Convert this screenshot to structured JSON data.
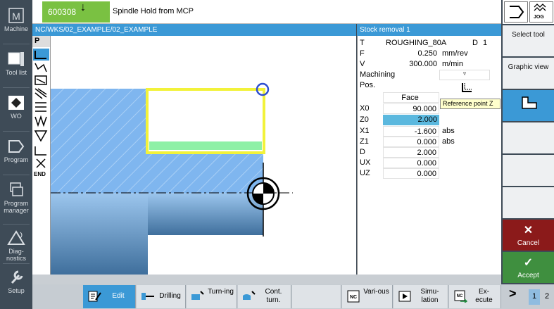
{
  "sidebar": {
    "items": [
      {
        "label": "Machine",
        "icon": "machine-icon"
      },
      {
        "label": "Tool list",
        "icon": "tool-list-icon"
      },
      {
        "label": "WO",
        "icon": "work-offset-icon"
      },
      {
        "label": "Program",
        "icon": "program-icon"
      },
      {
        "label": "Program manager",
        "icon": "program-manager-icon"
      },
      {
        "label": "Diag-nostics",
        "icon": "diagnostics-icon"
      },
      {
        "label": "Setup",
        "icon": "setup-icon"
      }
    ]
  },
  "header": {
    "alarm_number": "600308",
    "alarm_text": "Spindle Hold from MCP",
    "jog_label": "JOG"
  },
  "path": "NC/WKS/02_EXAMPLE/02_EXAMPLE",
  "cycle_title": "Stock removal 1",
  "strategy": {
    "p_label": "P",
    "end_label": "END"
  },
  "params": {
    "t_label": "T",
    "t_value": "ROUGHING_80A",
    "d_label": "D",
    "d_value": "1",
    "f_label": "F",
    "f_value": "0.250",
    "f_unit": "mm/rev",
    "v_label": "V",
    "v_value": "300.000",
    "v_unit": "m/min",
    "machining_label": "Machining",
    "machining_value": "▿",
    "pos_label": "Pos.",
    "face_value": "Face",
    "x0_label": "X0",
    "x0_value": "90.000",
    "z0_label": "Z0",
    "z0_value": "2.000",
    "x1_label": "X1",
    "x1_value": "-1.600",
    "x1_unit": "abs",
    "z1_label": "Z1",
    "z1_value": "0.000",
    "z1_unit": "abs",
    "d2_label": "D",
    "d2_value": "2.000",
    "ux_label": "UX",
    "ux_value": "0.000",
    "uz_label": "UZ",
    "uz_value": "0.000",
    "tooltip": "Reference point Z"
  },
  "right_keys": {
    "select_tool": "Select tool",
    "graphic_view": "Graphic view",
    "cancel": "Cancel",
    "accept": "Accept"
  },
  "bottom_keys": {
    "edit": "Edit",
    "drilling": "Drilling",
    "turning": "Turn-ing",
    "cont_turn": "Cont. turn.",
    "various": "Vari-ous",
    "simulation": "Simu-lation",
    "execute": "Ex-ecute",
    "more": ">",
    "page1": "1",
    "page2": "2"
  },
  "colors": {
    "accent_blue": "#3b99d6",
    "alarm_green": "#7ac142",
    "cancel_red": "#8b1a1a",
    "accept_green": "#3f8f3f",
    "part_blue": "#7fb6ef",
    "contour_yellow": "#f2f23a"
  }
}
